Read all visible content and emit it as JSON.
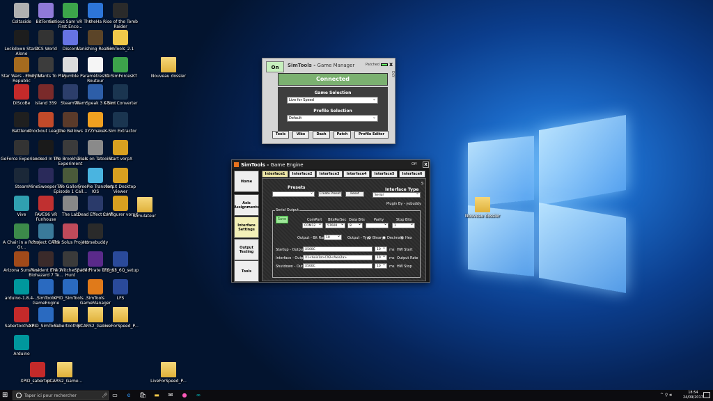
{
  "desktop_icons": [
    {
      "label": "Coltaside",
      "color": "#b0b0b0"
    },
    {
      "label": "BitTorrent",
      "color": "#8f7ad8"
    },
    {
      "label": "Serious Sam VR The First Enco...",
      "color": "#3ca54a"
    },
    {
      "label": "theHa",
      "color": "#2d75d8"
    },
    {
      "label": "Rise of the Tomb Raider",
      "color": "#2a2a2a"
    },
    {
      "label": "Lockdown Stand Alone",
      "color": "#1d1d1d"
    },
    {
      "label": "DCS World",
      "color": "#333"
    },
    {
      "label": "Discord",
      "color": "#6673e3"
    },
    {
      "label": "Vanishing Realms",
      "color": "#5b4428"
    },
    {
      "label": "SimTools_2.1",
      "color": "#f0c84a"
    },
    {
      "label": "Star Wars - The Old Republic",
      "color": "#a56b1f"
    },
    {
      "label": "Emily Wants To Play",
      "color": "#3c3c3c"
    },
    {
      "label": "Mumble",
      "color": "#dcdcdc"
    },
    {
      "label": "Paramètres du Routeur",
      "color": "#f5f5f5"
    },
    {
      "label": "3D SimForcesKT",
      "color": "#3da34b"
    },
    {
      "label": "DiScoBe",
      "color": "#c42a2a"
    },
    {
      "label": "Island 359",
      "color": "#7a2a2a"
    },
    {
      "label": "SteamVR",
      "color": "#2c3e6b"
    },
    {
      "label": "TeamSpeak 3 Client",
      "color": "#2d5ea8"
    },
    {
      "label": "X-Sim Converter",
      "color": "#1a3550"
    },
    {
      "label": "Battlenet",
      "color": "#1f1f1f"
    },
    {
      "label": "Knockout League",
      "color": "#c24a2a"
    },
    {
      "label": "The Bellows",
      "color": "#5a3a2a"
    },
    {
      "label": "XYZmaker",
      "color": "#f0a020"
    },
    {
      "label": "X-Sim Extractor",
      "color": "#1a3550"
    },
    {
      "label": "GeForce Experience",
      "color": "#333"
    },
    {
      "label": "Locked In VR",
      "color": "#1a1a1a"
    },
    {
      "label": "The Brookhaven Experiment",
      "color": "#3b3b3b"
    },
    {
      "label": "Trials on Tatooine",
      "color": "#8a8a8a"
    },
    {
      "label": "Start vorpX",
      "color": "#d8a020"
    },
    {
      "label": "Steam",
      "color": "#1b2838"
    },
    {
      "label": "MineSweeper VR",
      "color": "#2a2a5a"
    },
    {
      "label": "The Gallery - Episode 1 Call...",
      "color": "#4a5a3a"
    },
    {
      "label": "FreePie Transfert IOS",
      "color": "#4ab4e0"
    },
    {
      "label": "vorpX Desktop Viewer",
      "color": "#d8a020"
    },
    {
      "label": "Vive",
      "color": "#30a0b0"
    },
    {
      "label": "FAVE96 VR Funhouse",
      "color": "#c03030"
    },
    {
      "label": "The Lab",
      "color": "#888"
    },
    {
      "label": "Dead Effect 2 VR",
      "color": "#2a3a6a"
    },
    {
      "label": "Configurer vorpX",
      "color": "#d8a020"
    },
    {
      "label": "simulateur",
      "color": "folder"
    },
    {
      "label": "A Chair in a Room Gr...",
      "color": "#3c8a4a"
    },
    {
      "label": "Project CARS",
      "color": "#3a7a9a"
    },
    {
      "label": "The Solus Project",
      "color": "#c04a5a"
    },
    {
      "label": "Horsebuddy",
      "color": "#2a2a2a"
    },
    {
      "label": "Arizona Sunshine",
      "color": "#a04a1a"
    },
    {
      "label": "Resident Evil 7 Biohazard 7 Te...",
      "color": "#3a2a2a"
    },
    {
      "label": "The Witcher 3 Wild Hunt",
      "color": "#3a3a3a"
    },
    {
      "label": "Space Pirate Trainer",
      "color": "#5a2a8a"
    },
    {
      "label": "LFS_S3_6Q_setup",
      "color": "#2a4a9a"
    },
    {
      "label": "arduino-1.8.4-...",
      "color": "#00979d"
    },
    {
      "label": "SimTools GameEngine",
      "color": "#2a6ac0"
    },
    {
      "label": "XPID_SimTools...",
      "color": "#2a6ac0"
    },
    {
      "label": "SimTools GameManager",
      "color": "#e07a1a"
    },
    {
      "label": "LFS",
      "color": "#2a4a9a"
    },
    {
      "label": "SabertoothAdi...",
      "color": "#c42a2a"
    },
    {
      "label": "XPID_SimTools...",
      "color": "#2a6ac0"
    },
    {
      "label": "SabertoothRC...",
      "color": "folder"
    },
    {
      "label": "pCARS2_Game...",
      "color": "folder"
    },
    {
      "label": "LiveForSpeed_P...",
      "color": "folder"
    },
    {
      "label": "Arduino",
      "color": "#00979d"
    },
    {
      "label": "XPID_sabertoo...",
      "color": "#c42a2a"
    },
    {
      "label": "pCARS2_Game...",
      "color": "folder"
    },
    {
      "label": "Nouveau dossier",
      "color": "folder"
    },
    {
      "label": "LiveForSpeed_P...",
      "color": "folder"
    },
    {
      "label": "Nouveau dossier",
      "color": "folder"
    }
  ],
  "game_manager": {
    "on_label": "On",
    "title_bold": "SimTools - ",
    "title_rest": "Game Manager",
    "patched_label": "Patched",
    "close_label": "x",
    "dly_label": "DLY",
    "status": "Connected",
    "game_selection_label": "Game Selection",
    "game_selection_value": "Live for Speed",
    "profile_selection_label": "Profile Selection",
    "profile_selection_value": "Default",
    "tabs": [
      "Tools",
      "Vibe",
      "Dash",
      "Patch",
      "Profile Editor"
    ]
  },
  "game_engine": {
    "title_bold": "SimTools - ",
    "title_rest": "Game Engine",
    "off_label": "Off",
    "close_label": "x",
    "sidebar": [
      "Home",
      "Axis Assignments",
      "Interface Settings",
      "Output Testing",
      "Tools"
    ],
    "interface_tabs": [
      "Interface1",
      "Interface2",
      "Interface3",
      "Interface4",
      "Interface5",
      "Interface6"
    ],
    "presets_label": "Presets",
    "create_preset_label": "Create Preset",
    "reset_label": "Reset",
    "interface_type_label": "Interface Type",
    "interface_type_value": "Serial",
    "plugin_by": "Plugin By - yobuddy",
    "serial_output_label": "Serial Output",
    "save_label": "Save",
    "comport_label": "ComPort",
    "comport_value": "COM12",
    "bits_label": "BitsPerSec",
    "bits_value": "57600",
    "databits_label": "Data Bits",
    "databits_value": "8",
    "parity_label": "Parity",
    "parity_value": "",
    "stopbits_label": "Stop Bits",
    "stopbits_value": "1",
    "bitrange_label": "Output - Bit Range",
    "bitrange_value": "10",
    "outtype_label": "Output - Type",
    "binary_label": "Binary",
    "decimal_label": "Decimal",
    "hex_label": "Hex",
    "startup_label": "Startup - Output",
    "startup_value": "X500C",
    "startup_ms": "10",
    "interface_label": "Interface - Output",
    "interface_value": "X1<Axis1a>CX2<Axis2a>",
    "interface_ms": "10",
    "shutdown_label": "Shutdown - Output",
    "shutdown_value": "X500C",
    "shutdown_ms": "10",
    "ms_label": "ms",
    "hw_start_label": "HW Start",
    "output_rate_label": "Output Rate",
    "hw_stop_label": "HW Stop",
    "corner_mark": "S"
  },
  "taskbar": {
    "search_placeholder": "Taper ici pour rechercher",
    "clock_time": "18:54",
    "clock_date": "24/09/2017"
  },
  "colors": {
    "accent_green": "#7bb070",
    "save_green": "#9fe89a",
    "orange": "#e9721d"
  }
}
